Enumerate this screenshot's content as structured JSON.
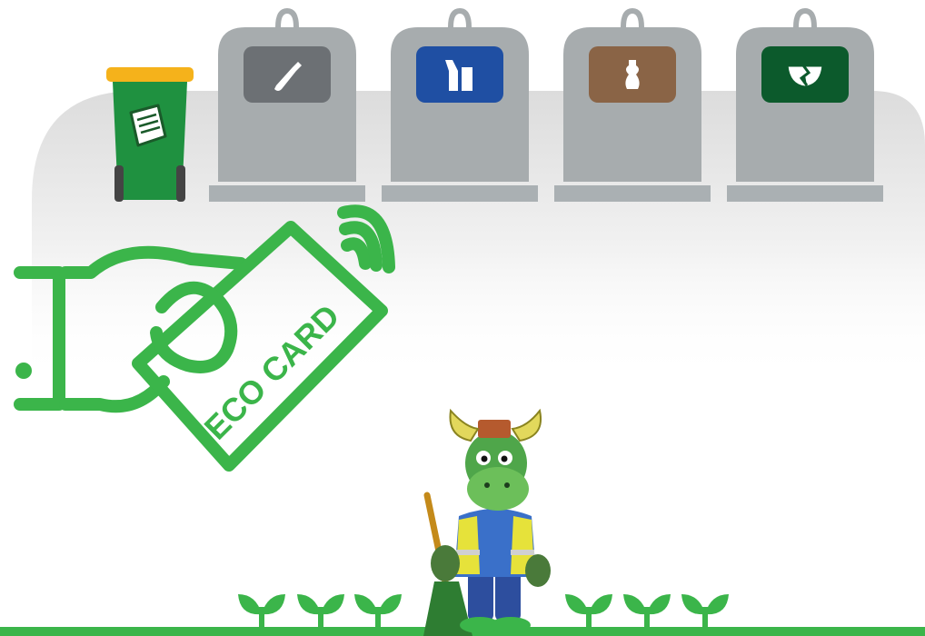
{
  "eco_card": {
    "label": "ECO CARD"
  },
  "containers": [
    {
      "waste_type": "general",
      "icon": "plastic-bottle-icon",
      "panel_color": "#6c7074"
    },
    {
      "waste_type": "packaging",
      "icon": "cans-and-bottle-icon",
      "panel_color": "#1f4fa3"
    },
    {
      "waste_type": "organic",
      "icon": "apple-core-icon",
      "panel_color": "#8a6446"
    },
    {
      "waste_type": "glass",
      "icon": "broken-bowl-icon",
      "panel_color": "#0c5a2c"
    }
  ],
  "wheelie_bin": {
    "waste_type": "paper",
    "icon": "paper-document-icon",
    "body_color": "#1f9140",
    "lid_color": "#f5b21b"
  },
  "colors": {
    "brand_green": "#3bb54a",
    "container_grey": "#a7acae",
    "container_base": "#aab0b3",
    "background_panel": "#e8e8e8",
    "ground": "#3bb54a"
  },
  "mascot": {
    "description_icon": "bull-mascot-with-broom-icon"
  }
}
